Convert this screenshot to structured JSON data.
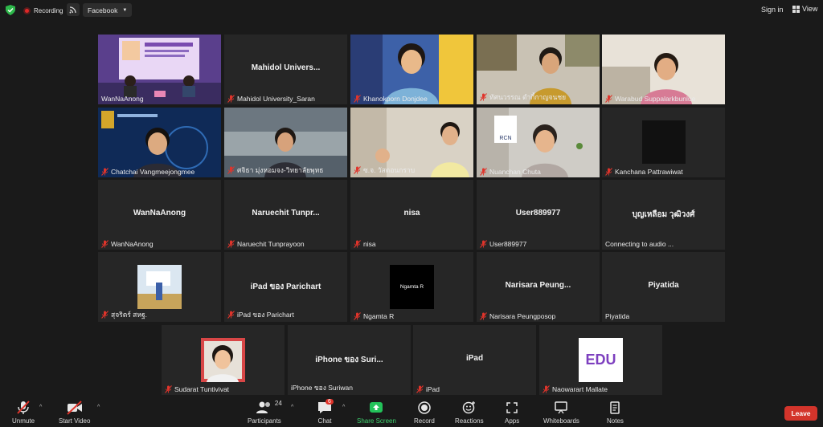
{
  "topbar": {
    "recording_label": "Recording",
    "stream_label": "Facebook",
    "signin_label": "Sign in",
    "view_label": "View"
  },
  "tiles": [
    {
      "name": "WanNaAnong",
      "center": "",
      "muted": false
    },
    {
      "name": "Mahidol University_Saran",
      "center": "Mahidol Univers...",
      "muted": true
    },
    {
      "name": "Khanokporn Donjdee",
      "center": "",
      "muted": true
    },
    {
      "name": "ทัศนวรรณ  ตำกี้กาญจนชย",
      "center": "",
      "muted": true
    },
    {
      "name": "Warabud Suppalarkbunlue",
      "center": "",
      "muted": true
    },
    {
      "name": "Chatchai Vangmeejongmee",
      "center": "",
      "muted": true
    },
    {
      "name": "ศจิธา  มุ่งหอมจง-วิทยาลัยพุทธ",
      "center": "",
      "muted": true
    },
    {
      "name": "ซ.จ. วัสดอนกราบ",
      "center": "",
      "muted": true
    },
    {
      "name": "Nuanchan Chuta",
      "center": "",
      "muted": true
    },
    {
      "name": "Kanchana Pattrawiwat",
      "center": "",
      "muted": true
    },
    {
      "name": "WanNaAnong",
      "center": "WanNaAnong",
      "muted": true
    },
    {
      "name": "Naruechit Tunprayoon",
      "center": "Naruechit  Tunpr...",
      "muted": true
    },
    {
      "name": "nisa",
      "center": "nisa",
      "muted": true
    },
    {
      "name": "User889977",
      "center": "User889977",
      "muted": true
    },
    {
      "name": "Connecting to audio ...",
      "center": "บุญเหลือม วุฒิวงศ์",
      "muted": false
    },
    {
      "name": "สุจริตร์ สหฐ.",
      "center": "",
      "muted": true
    },
    {
      "name": "iPad ของ Parichart",
      "center": "iPad ของ Parichart",
      "muted": true
    },
    {
      "name": "Ngamta R",
      "center": "",
      "muted": true,
      "thumb_text": "Ngamta R"
    },
    {
      "name": "Narisara Peungposop",
      "center": "Narisara  Peung...",
      "muted": true
    },
    {
      "name": "Piyatida",
      "center": "Piyatida",
      "muted": false
    },
    {
      "name": "Sudarat Tuntivivat",
      "center": "",
      "muted": true
    },
    {
      "name": "iPhone ของ Suriwan",
      "center": "iPhone ของ Suri...",
      "muted": false
    },
    {
      "name": "iPad",
      "center": "iPad",
      "muted": true
    },
    {
      "name": "Naowarart Mallate",
      "center": "",
      "muted": true,
      "thumb_text": "EDU"
    }
  ],
  "bottombar": {
    "unmute": "Unmute",
    "start_video": "Start Video",
    "participants": "Participants",
    "participants_count": "24",
    "chat": "Chat",
    "chat_badge": "6",
    "share_screen": "Share Screen",
    "record": "Record",
    "reactions": "Reactions",
    "apps": "Apps",
    "whiteboards": "Whiteboards",
    "notes": "Notes",
    "leave": "Leave"
  },
  "colors": {
    "background": "#1a1a1a",
    "tile": "#262626",
    "active_outline": "#e6c84a",
    "muted_red": "#e0342b",
    "share_green": "#23c35a",
    "leave_red": "#d3342b"
  }
}
